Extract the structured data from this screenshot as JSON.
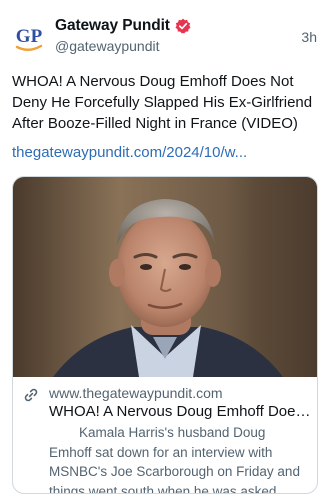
{
  "post": {
    "author": {
      "display_name": "Gateway Pundit",
      "handle": "@gatewaypundit",
      "avatar_text": "GP",
      "verified": true,
      "avatar_color": "#2e4fa3",
      "accent_color": "#f0a13a"
    },
    "timestamp": "3h",
    "text": "WHOA! A Nervous Doug Emhoff Does Not Deny He Forcefully Slapped His Ex-Girlfriend After Booze-Filled Night in France (VIDEO)",
    "link_text": "thegatewaypundit.com/2024/10/w...",
    "link_color": "#2e6db5",
    "card": {
      "image_icon": "man-portrait-photo",
      "link_icon": "link-icon",
      "domain": "www.thegatewaypundit.com",
      "title": "WHOA! A Nervous Doug Emhoff Does Not Deny He Forcefully Slapped His Ex-Girlfriend After Booze-Filled Night in France (VIDEO)",
      "description": "Kamala Harris's husband Doug Emhoff sat down for an interview with MSNBC's Joe Scarborough on Friday and things went south when he was asked about \"forcefully\" smacking his ex-girlfriend"
    }
  }
}
